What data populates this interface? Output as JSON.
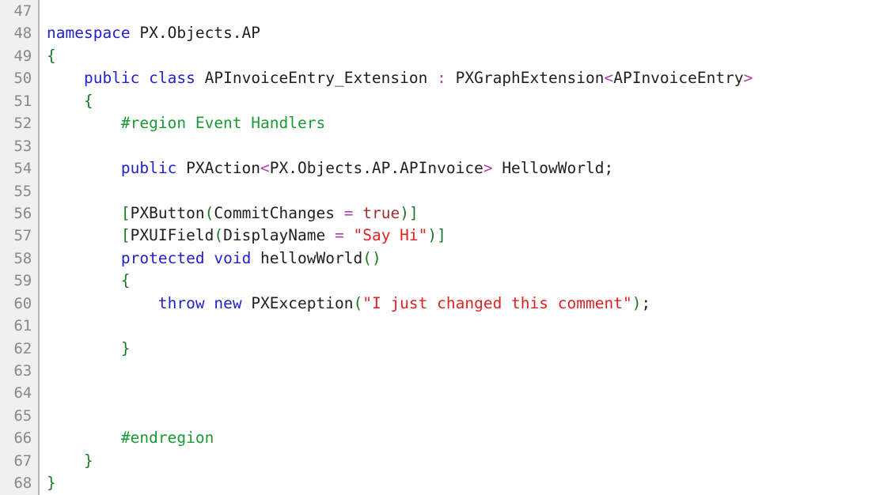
{
  "editor": {
    "language": "csharp",
    "background": "#ffffff",
    "gutter_background": "#f0f0f0",
    "gutter_divider_color": "#b8b8b8",
    "line_number_color": "#888888",
    "first_visible_line": 47,
    "last_visible_line": 68,
    "colors": {
      "keyword": "#2222cc",
      "brace": "#1a7a27",
      "preprocessor": "#1a9a33",
      "string": "#dd2222",
      "operator": "#b040b0",
      "constant": "#a03030",
      "plain": "#1f1f1f"
    }
  },
  "lines": [
    {
      "number": "47",
      "tokens": []
    },
    {
      "number": "48",
      "tokens": [
        {
          "t": "namespace",
          "c": "kw"
        },
        {
          "t": " PX.Objects.AP",
          "c": "plain"
        }
      ]
    },
    {
      "number": "49",
      "tokens": [
        {
          "t": "{",
          "c": "brace"
        }
      ]
    },
    {
      "number": "50",
      "tokens": [
        {
          "t": "    ",
          "c": "plain"
        },
        {
          "t": "public",
          "c": "kw"
        },
        {
          "t": " ",
          "c": "plain"
        },
        {
          "t": "class",
          "c": "kw"
        },
        {
          "t": " APInvoiceEntry_Extension ",
          "c": "plain"
        },
        {
          "t": ":",
          "c": "op"
        },
        {
          "t": " PXGraphExtension",
          "c": "plain"
        },
        {
          "t": "<",
          "c": "op"
        },
        {
          "t": "APInvoiceEntry",
          "c": "plain"
        },
        {
          "t": ">",
          "c": "op"
        }
      ]
    },
    {
      "number": "51",
      "tokens": [
        {
          "t": "    ",
          "c": "plain"
        },
        {
          "t": "{",
          "c": "brace"
        }
      ]
    },
    {
      "number": "52",
      "tokens": [
        {
          "t": "        ",
          "c": "plain"
        },
        {
          "t": "#region Event Handlers",
          "c": "pp"
        }
      ]
    },
    {
      "number": "53",
      "tokens": []
    },
    {
      "number": "54",
      "tokens": [
        {
          "t": "        ",
          "c": "plain"
        },
        {
          "t": "public",
          "c": "kw"
        },
        {
          "t": " PXAction",
          "c": "plain"
        },
        {
          "t": "<",
          "c": "op"
        },
        {
          "t": "PX.Objects.AP.APInvoice",
          "c": "plain"
        },
        {
          "t": ">",
          "c": "op"
        },
        {
          "t": " HellowWorld;",
          "c": "plain"
        }
      ]
    },
    {
      "number": "55",
      "tokens": []
    },
    {
      "number": "56",
      "tokens": [
        {
          "t": "        ",
          "c": "plain"
        },
        {
          "t": "[",
          "c": "brace"
        },
        {
          "t": "PXButton",
          "c": "plain"
        },
        {
          "t": "(",
          "c": "brace"
        },
        {
          "t": "CommitChanges ",
          "c": "plain"
        },
        {
          "t": "=",
          "c": "op"
        },
        {
          "t": " ",
          "c": "plain"
        },
        {
          "t": "true",
          "c": "const"
        },
        {
          "t": ")",
          "c": "brace"
        },
        {
          "t": "]",
          "c": "brace"
        }
      ]
    },
    {
      "number": "57",
      "tokens": [
        {
          "t": "        ",
          "c": "plain"
        },
        {
          "t": "[",
          "c": "brace"
        },
        {
          "t": "PXUIField",
          "c": "plain"
        },
        {
          "t": "(",
          "c": "brace"
        },
        {
          "t": "DisplayName ",
          "c": "plain"
        },
        {
          "t": "=",
          "c": "op"
        },
        {
          "t": " ",
          "c": "plain"
        },
        {
          "t": "\"Say Hi\"",
          "c": "str"
        },
        {
          "t": ")",
          "c": "brace"
        },
        {
          "t": "]",
          "c": "brace"
        }
      ]
    },
    {
      "number": "58",
      "tokens": [
        {
          "t": "        ",
          "c": "plain"
        },
        {
          "t": "protected",
          "c": "kw"
        },
        {
          "t": " ",
          "c": "plain"
        },
        {
          "t": "void",
          "c": "kw"
        },
        {
          "t": " hellowWorld",
          "c": "plain"
        },
        {
          "t": "(",
          "c": "brace"
        },
        {
          "t": ")",
          "c": "brace"
        }
      ]
    },
    {
      "number": "59",
      "tokens": [
        {
          "t": "        ",
          "c": "plain"
        },
        {
          "t": "{",
          "c": "brace"
        }
      ]
    },
    {
      "number": "60",
      "tokens": [
        {
          "t": "            ",
          "c": "plain"
        },
        {
          "t": "throw",
          "c": "kw"
        },
        {
          "t": " ",
          "c": "plain"
        },
        {
          "t": "new",
          "c": "kw"
        },
        {
          "t": " PXException",
          "c": "plain"
        },
        {
          "t": "(",
          "c": "brace"
        },
        {
          "t": "\"I just changed this comment\"",
          "c": "str"
        },
        {
          "t": ")",
          "c": "brace"
        },
        {
          "t": ";",
          "c": "plain"
        }
      ]
    },
    {
      "number": "61",
      "tokens": []
    },
    {
      "number": "62",
      "tokens": [
        {
          "t": "        ",
          "c": "plain"
        },
        {
          "t": "}",
          "c": "brace"
        }
      ]
    },
    {
      "number": "63",
      "tokens": []
    },
    {
      "number": "64",
      "tokens": []
    },
    {
      "number": "65",
      "tokens": []
    },
    {
      "number": "66",
      "tokens": [
        {
          "t": "        ",
          "c": "plain"
        },
        {
          "t": "#endregion",
          "c": "pp"
        }
      ]
    },
    {
      "number": "67",
      "tokens": [
        {
          "t": "    ",
          "c": "plain"
        },
        {
          "t": "}",
          "c": "brace"
        }
      ]
    },
    {
      "number": "68",
      "tokens": [
        {
          "t": "}",
          "c": "brace"
        }
      ]
    }
  ]
}
